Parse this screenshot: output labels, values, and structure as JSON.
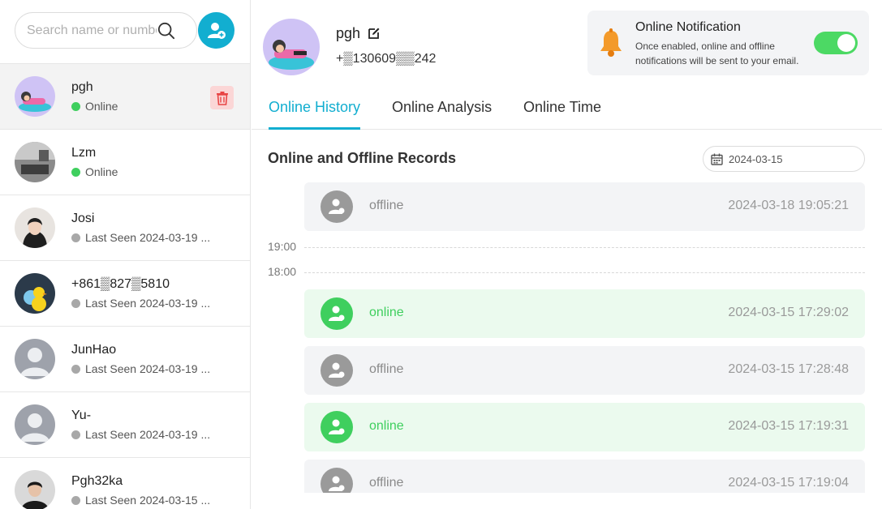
{
  "search": {
    "placeholder": "Search name or number"
  },
  "contacts": [
    {
      "name": "pgh",
      "status": "Online",
      "online": true
    },
    {
      "name": "Lzm",
      "status": "Online",
      "online": true
    },
    {
      "name": "Josi",
      "status": "Last Seen 2024-03-19 ...",
      "online": false
    },
    {
      "name": "+861▒827▒5810",
      "status": "Last Seen 2024-03-19 ...",
      "online": false
    },
    {
      "name": "JunHao",
      "status": "Last Seen 2024-03-19 ...",
      "online": false
    },
    {
      "name": "Yu-",
      "status": "Last Seen 2024-03-19 ...",
      "online": false
    },
    {
      "name": "Pgh32ka",
      "status": "Last Seen 2024-03-15 ...",
      "online": false
    }
  ],
  "profile": {
    "name": "pgh",
    "phone": "+▒130609▒▒242"
  },
  "notification": {
    "title": "Online Notification",
    "description": "Once enabled, online and offline notifications will be sent to your email.",
    "enabled": true
  },
  "tabs": [
    "Online History",
    "Online Analysis",
    "Online Time"
  ],
  "records_section": {
    "title": "Online and Offline Records",
    "date": "2024-03-15"
  },
  "time_marks": [
    "19:00",
    "18:00"
  ],
  "records": [
    {
      "status": "offline",
      "time": "2024-03-18 19:05:21"
    },
    {
      "status": "online",
      "time": "2024-03-15 17:29:02"
    },
    {
      "status": "offline",
      "time": "2024-03-15 17:28:48"
    },
    {
      "status": "online",
      "time": "2024-03-15 17:19:31"
    },
    {
      "status": "offline",
      "time": "2024-03-15 17:19:04"
    }
  ],
  "colors": {
    "accent": "#12aed0",
    "online": "#3fcf5e",
    "offline": "#9a9a9a",
    "danger": "#e84545"
  }
}
